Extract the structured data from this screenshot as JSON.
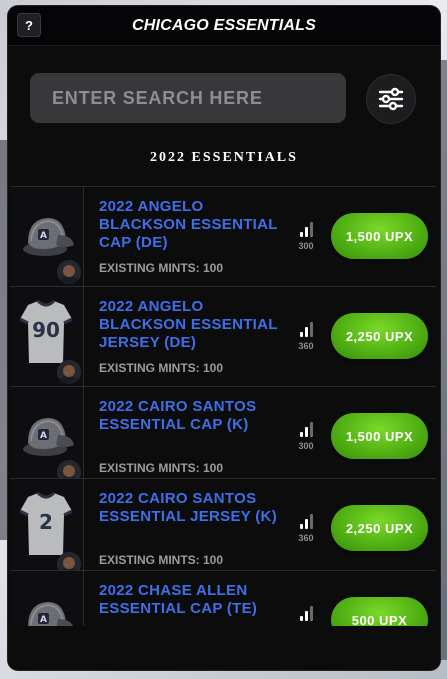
{
  "header": {
    "help_label": "?",
    "title": "CHICAGO ESSENTIALS"
  },
  "search": {
    "placeholder": "ENTER SEARCH HERE",
    "value": ""
  },
  "filter": {
    "icon": "sliders-icon"
  },
  "section": {
    "title": "2022 ESSENTIALS"
  },
  "colors": {
    "accent_blue": "#3f6fe8",
    "price_green": "#4fae12",
    "panel_bg": "#0c0c0d"
  },
  "items": [
    {
      "name": "2022 ANGELO BLACKSON ESSENTIAL CAP (DE)",
      "mints": "EXISTING MINTS: 100",
      "rank": "300",
      "price": "1,500 UPX",
      "kind": "cap"
    },
    {
      "name": "2022 ANGELO BLACKSON ESSENTIAL JERSEY (DE)",
      "mints": "EXISTING MINTS: 100",
      "rank": "360",
      "price": "2,250 UPX",
      "kind": "jersey",
      "jersey_number": "90"
    },
    {
      "name": "2022 CAIRO SANTOS ESSENTIAL CAP (K)",
      "mints": "EXISTING MINTS: 100",
      "rank": "300",
      "price": "1,500 UPX",
      "kind": "cap"
    },
    {
      "name": "2022 CAIRO SANTOS ESSENTIAL JERSEY (K)",
      "mints": "EXISTING MINTS: 100",
      "rank": "360",
      "price": "2,250 UPX",
      "kind": "jersey",
      "jersey_number": "2"
    },
    {
      "name": "2022 CHASE ALLEN ESSENTIAL CAP (TE)",
      "mints": "",
      "rank": "",
      "price": "500 UPX",
      "kind": "cap"
    }
  ]
}
